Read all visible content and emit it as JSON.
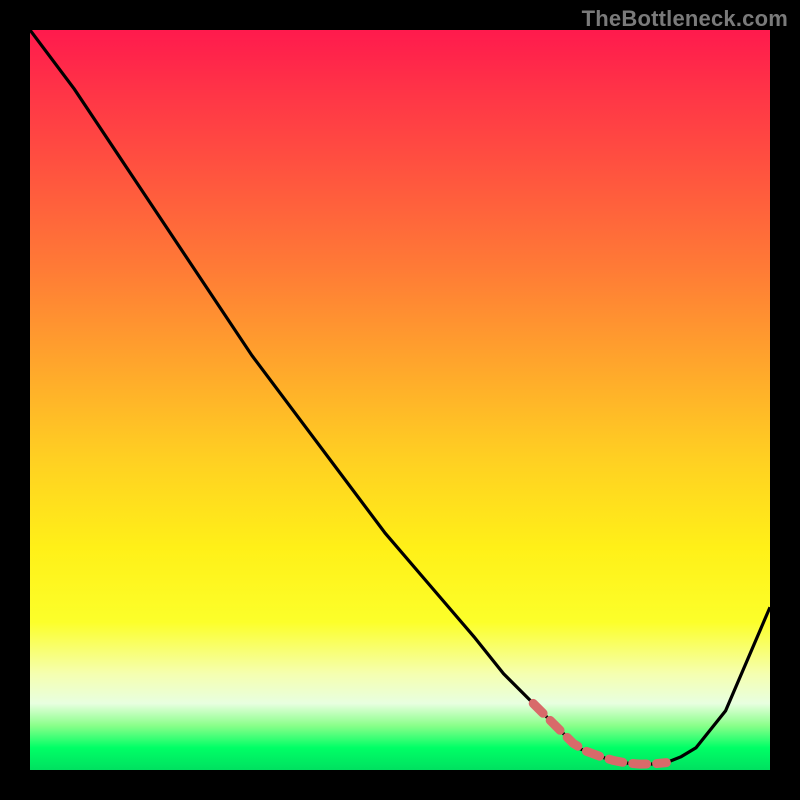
{
  "watermark": "TheBottleneck.com",
  "chart_data": {
    "type": "line",
    "title": "",
    "xlabel": "",
    "ylabel": "",
    "xlim": [
      0,
      100
    ],
    "ylim": [
      0,
      100
    ],
    "series": [
      {
        "name": "bottleneck-curve",
        "x": [
          0,
          6,
          12,
          18,
          24,
          30,
          36,
          42,
          48,
          54,
          60,
          64,
          68,
          70,
          72,
          74,
          76,
          78,
          80,
          82,
          84,
          86,
          88,
          90,
          94,
          100
        ],
        "values": [
          100,
          92,
          83,
          74,
          65,
          56,
          48,
          40,
          32,
          25,
          18,
          13,
          9,
          7,
          5,
          3,
          2.2,
          1.5,
          1,
          0.8,
          0.8,
          1,
          1.8,
          3,
          8,
          22
        ]
      }
    ],
    "annotations": [
      {
        "name": "flat-zone-marker",
        "x_start": 68,
        "x_end": 86,
        "y": 1.5,
        "style": "dashed",
        "color": "#d86a6a"
      }
    ],
    "colors": {
      "curve": "#000000",
      "marker": "#d86a6a",
      "background_top": "#ff1a4d",
      "background_bottom": "#00e060"
    }
  }
}
